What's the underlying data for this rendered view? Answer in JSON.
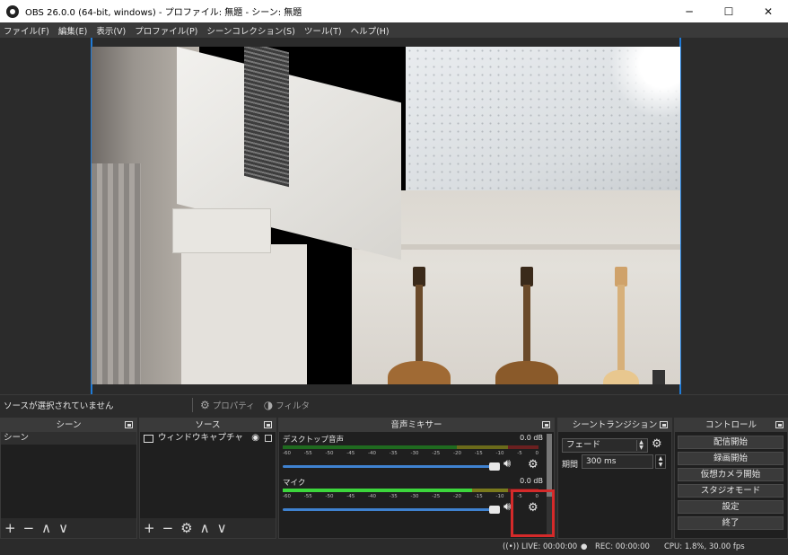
{
  "titlebar": {
    "title": "OBS 26.0.0 (64-bit, windows) - プロファイル: 無題 - シーン: 無題",
    "minimize": "─",
    "maximize": "☐",
    "close": "✕"
  },
  "menu": [
    "ファイル(F)",
    "編集(E)",
    "表示(V)",
    "プロファイル(P)",
    "シーンコレクション(S)",
    "ツール(T)",
    "ヘルプ(H)"
  ],
  "selection_bar": {
    "no_source": "ソースが選択されていません",
    "properties": "プロパティ",
    "filters": "フィルタ"
  },
  "scenes": {
    "title": "シーン",
    "items": [
      "シーン"
    ],
    "toolbar": [
      "+",
      "−",
      "∧",
      "∨"
    ]
  },
  "sources": {
    "title": "ソース",
    "items": [
      "ウィンドウキャプチャ"
    ],
    "toolbar": [
      "+",
      "−",
      "⚙",
      "∧",
      "∨"
    ]
  },
  "mixer": {
    "title": "音声ミキサー",
    "ticks": [
      "-60",
      "-55",
      "-50",
      "-45",
      "-40",
      "-35",
      "-30",
      "-25",
      "-20",
      "-15",
      "-10",
      "-5",
      "0"
    ],
    "tracks": [
      {
        "name": "デスクトップ音声",
        "db": "0.0 dB",
        "level": 0,
        "volume": 1.0
      },
      {
        "name": "マイク",
        "db": "0.0 dB",
        "level": 0.74,
        "volume": 1.0
      }
    ]
  },
  "transitions": {
    "title": "シーントランジション",
    "selected": "フェード",
    "duration_label": "期間",
    "duration_value": "300 ms"
  },
  "controls": {
    "title": "コントロール",
    "buttons": [
      "配信開始",
      "録画開始",
      "仮想カメラ開始",
      "スタジオモード",
      "設定",
      "終了"
    ]
  },
  "status": {
    "live": "LIVE: 00:00:00",
    "rec": "REC: 00:00:00",
    "cpu": "CPU: 1.8%, 30.00 fps"
  },
  "colors": {
    "accent": "#3f82d0",
    "highlight": "#d42a2a",
    "meter_green": "#3cd63c"
  }
}
